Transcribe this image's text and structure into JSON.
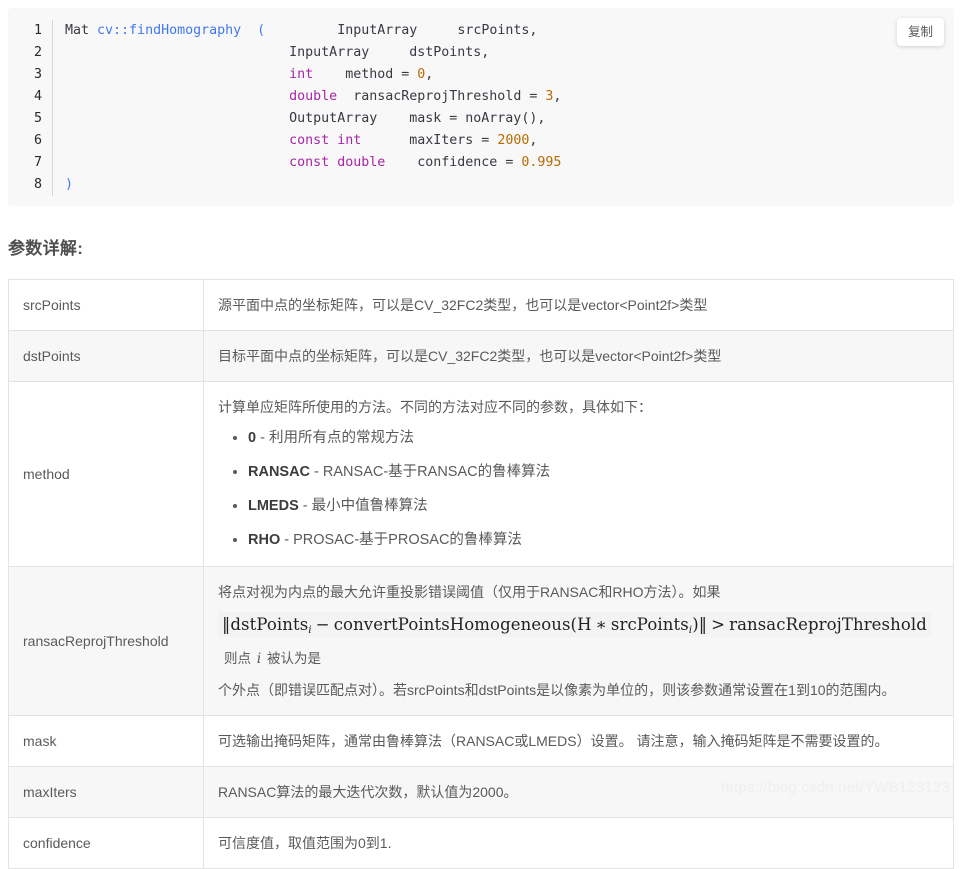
{
  "code_block": {
    "copy_label": "复制",
    "line_numbers": [
      "1",
      "2",
      "3",
      "4",
      "5",
      "6",
      "7",
      "8"
    ],
    "lines": [
      [
        {
          "t": "Mat ",
          "c": "txt"
        },
        {
          "t": "cv::findHomography",
          "c": "fn"
        },
        {
          "t": "  ",
          "c": "txt"
        },
        {
          "t": "(",
          "c": "pun"
        },
        {
          "t": "         ",
          "c": "txt"
        },
        {
          "t": "InputArray",
          "c": "txt"
        },
        {
          "t": "     ",
          "c": "txt"
        },
        {
          "t": "srcPoints,",
          "c": "txt"
        }
      ],
      [
        {
          "t": "                            ",
          "c": "txt"
        },
        {
          "t": "InputArray",
          "c": "txt"
        },
        {
          "t": "     ",
          "c": "txt"
        },
        {
          "t": "dstPoints,",
          "c": "txt"
        }
      ],
      [
        {
          "t": "                            ",
          "c": "txt"
        },
        {
          "t": "int",
          "c": "kw"
        },
        {
          "t": "    method = ",
          "c": "txt"
        },
        {
          "t": "0",
          "c": "num"
        },
        {
          "t": ",",
          "c": "txt"
        }
      ],
      [
        {
          "t": "                            ",
          "c": "txt"
        },
        {
          "t": "double",
          "c": "kw"
        },
        {
          "t": "  ransacReprojThreshold = ",
          "c": "txt"
        },
        {
          "t": "3",
          "c": "num"
        },
        {
          "t": ",",
          "c": "txt"
        }
      ],
      [
        {
          "t": "                            ",
          "c": "txt"
        },
        {
          "t": "OutputArray",
          "c": "txt"
        },
        {
          "t": "    mask = noArray(),",
          "c": "txt"
        }
      ],
      [
        {
          "t": "                            ",
          "c": "txt"
        },
        {
          "t": "const int",
          "c": "kw"
        },
        {
          "t": "      maxIters = ",
          "c": "txt"
        },
        {
          "t": "2000",
          "c": "num"
        },
        {
          "t": ",",
          "c": "txt"
        }
      ],
      [
        {
          "t": "                            ",
          "c": "txt"
        },
        {
          "t": "const double",
          "c": "kw"
        },
        {
          "t": "    confidence = ",
          "c": "txt"
        },
        {
          "t": "0.995",
          "c": "num"
        }
      ],
      [
        {
          "t": ")",
          "c": "pun"
        }
      ]
    ]
  },
  "section": {
    "title": "参数详解:"
  },
  "table": {
    "rows": [
      {
        "name": "srcPoints",
        "desc": "源平面中点的坐标矩阵，可以是CV_32FC2类型，也可以是vector<Point2f>类型"
      },
      {
        "name": "dstPoints",
        "desc": "目标平面中点的坐标矩阵，可以是CV_32FC2类型，也可以是vector<Point2f>类型"
      },
      {
        "name": "method",
        "desc": "计算单应矩阵所使用的方法。不同的方法对应不同的参数，具体如下：",
        "options": [
          {
            "key": "0",
            "sep": " - ",
            "text": "利用所有点的常规方法"
          },
          {
            "key": "RANSAC",
            "sep": " - ",
            "text": "RANSAC-基于RANSAC的鲁棒算法"
          },
          {
            "key": "LMEDS",
            "sep": " - ",
            "text": "最小中值鲁棒算法"
          },
          {
            "key": "RHO",
            "sep": " - ",
            "text": "PROSAC-基于PROSAC的鲁棒算法"
          }
        ]
      },
      {
        "name": "ransacReprojThreshold",
        "desc_before": "将点对视为内点的最大允许重投影错误阈值（仅用于RANSAC和RHO方法）。如果",
        "formula": {
          "bar_open": "‖",
          "term1": "dstPoints",
          "sub1": "i",
          "minus": "−",
          "func": "convertPointsHomogeneous",
          "paren_open": "(",
          "h": "H",
          "times": "∗",
          "term2": "srcPoints",
          "sub2": "i",
          "paren_close": ")",
          "bar_close": "‖",
          "gt": ">",
          "rhs": "ransacReprojThreshold"
        },
        "after_formula_prefix": "则点 ",
        "after_formula_italic": "i",
        "after_formula_suffix": " 被认为是",
        "desc_after": "个外点（即错误匹配点对）。若srcPoints和dstPoints是以像素为单位的，则该参数通常设置在1到10的范围内。"
      },
      {
        "name": "mask",
        "desc": "可选输出掩码矩阵，通常由鲁棒算法（RANSAC或LMEDS）设置。 请注意，输入掩码矩阵是不需要设置的。"
      },
      {
        "name": "maxIters",
        "desc": "RANSAC算法的最大迭代次数，默认值为2000。"
      },
      {
        "name": "confidence",
        "desc": "可信度值，取值范围为0到1."
      }
    ]
  },
  "watermark": {
    "text": "https://blog.csdn.net/YWB123123"
  }
}
